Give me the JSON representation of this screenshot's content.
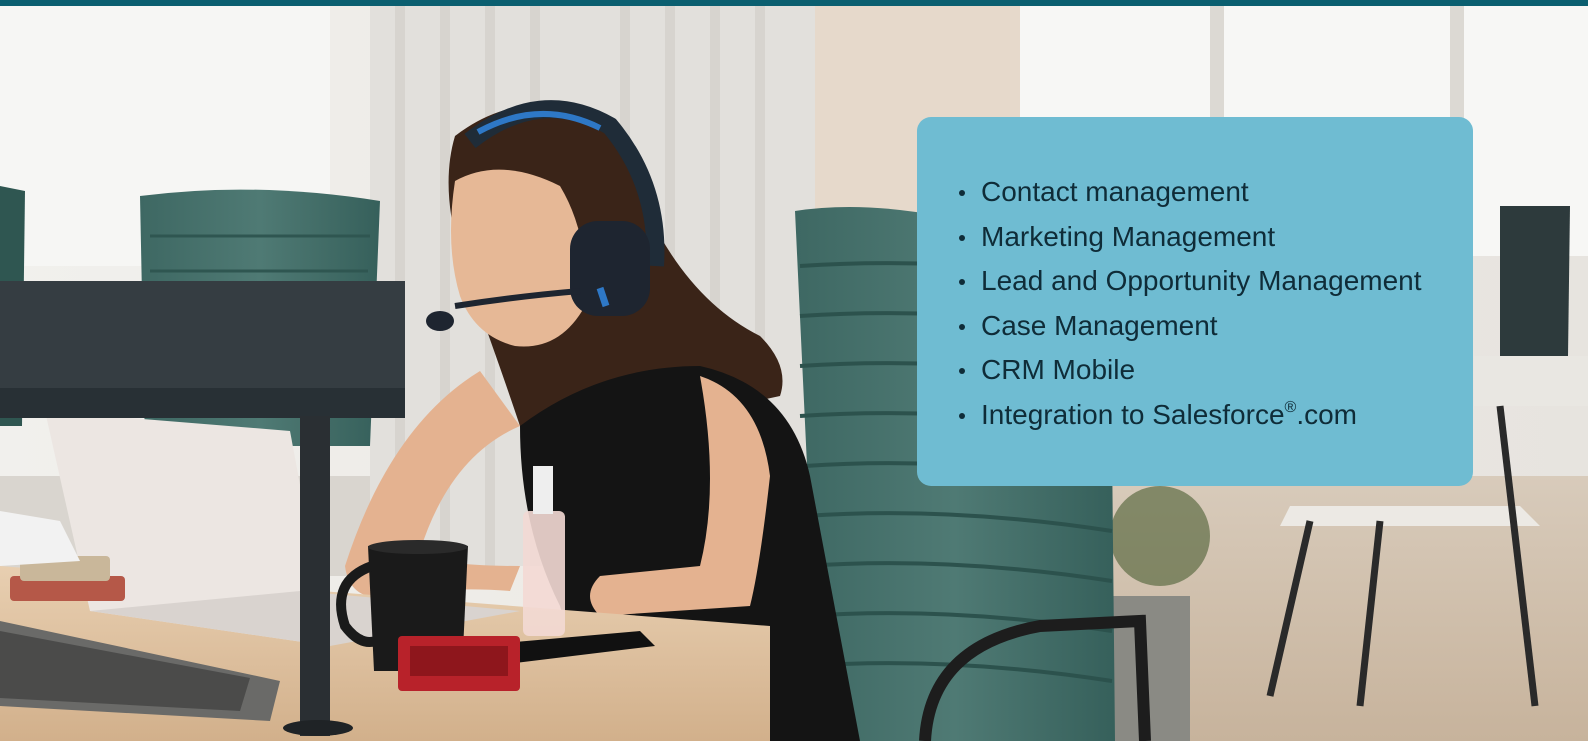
{
  "banner": {
    "top_bar_color": "#0b5f70",
    "photo": {
      "subject_icon": "call-center-agent-with-headset-icon",
      "background_color": "#c9c4bc"
    },
    "feature_card": {
      "background_color": "#6fbcd2",
      "text_color": "#0f2c38",
      "items": [
        "Contact management",
        "Marketing Management",
        "Lead and Opportunity Management",
        "Case Management",
        "CRM Mobile"
      ],
      "last_item": {
        "prefix": "Integration to Salesforce",
        "mark": "®",
        "suffix": ".com"
      }
    }
  }
}
